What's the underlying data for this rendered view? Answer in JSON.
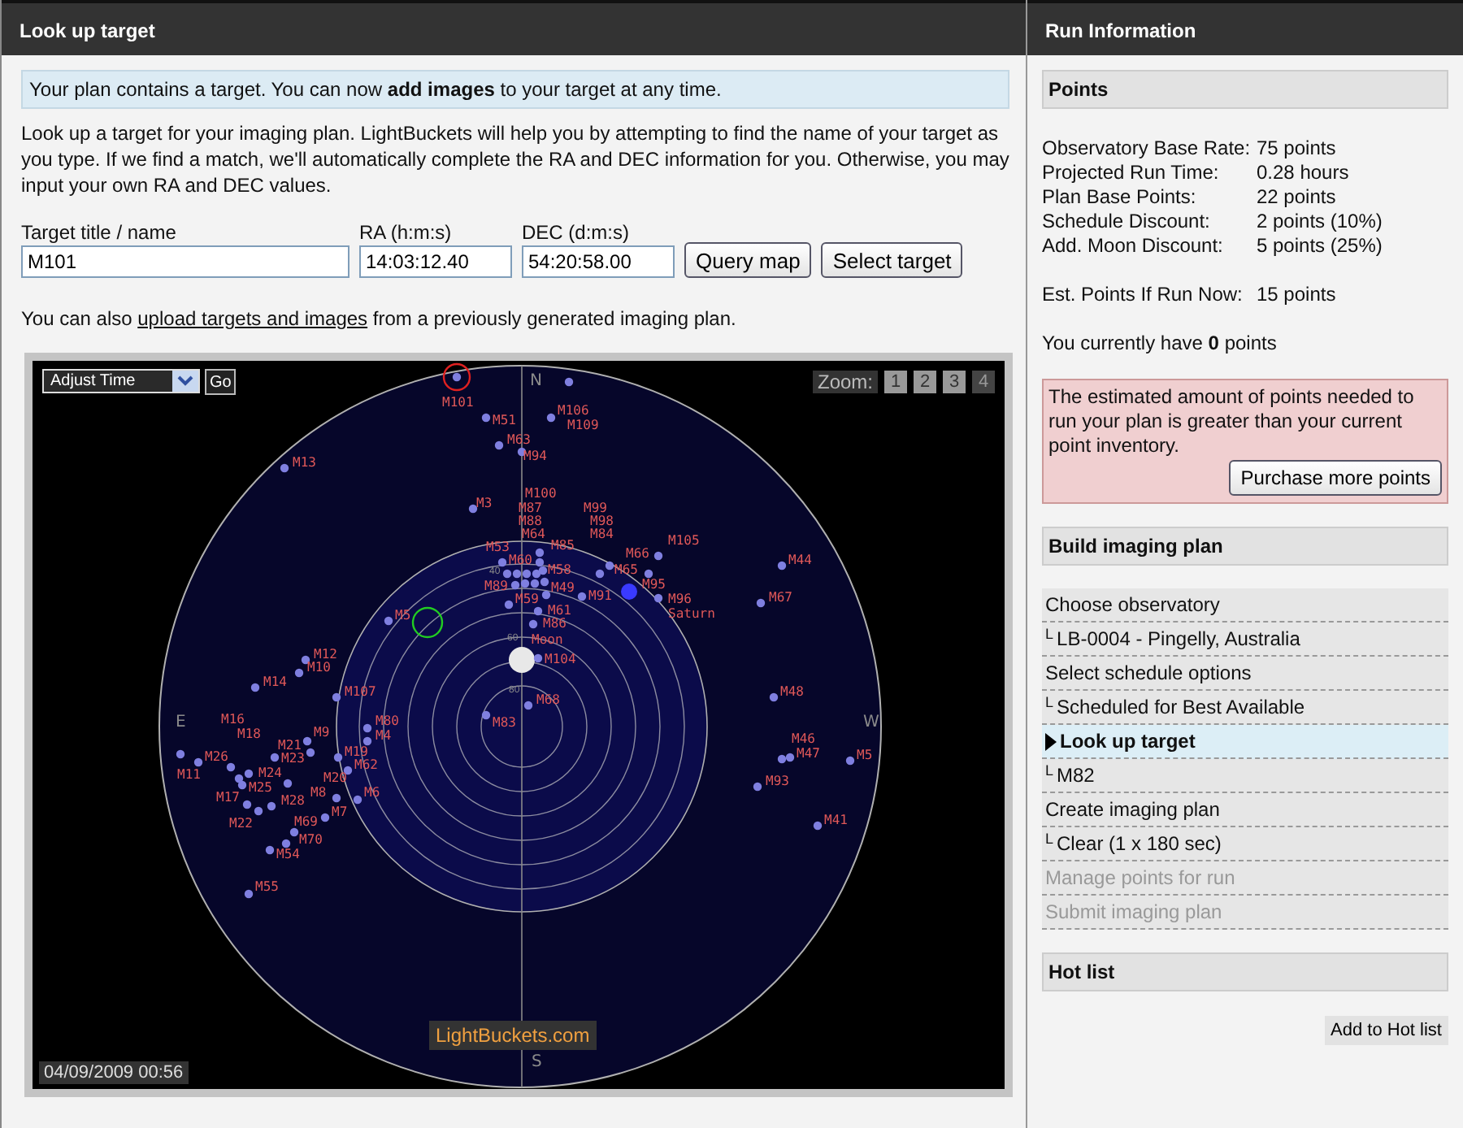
{
  "left_panel": {
    "title": "Look up target",
    "notice": "Your plan contains a target. You can now **add images** to your target at any time.",
    "intro": "Look up a target for your imaging plan. LightBuckets will help you by attempting to find the name of your target as you type. If we find a match, we'll automatically complete the RA and DEC information for you. Otherwise, you may input your own RA and DEC values.",
    "fields": [
      {
        "label": "Target title / name",
        "value": "M101"
      },
      {
        "label": "RA (h:m:s)",
        "value": "14:03:12.40"
      },
      {
        "label": "DEC (d:m:s)",
        "value": "54:20:58.00"
      }
    ],
    "buttons": [
      "Query map",
      "Select target"
    ],
    "upload_note": {
      "before": "You can also ",
      "link": "upload targets and images",
      "after": " from a previously generated imaging plan."
    },
    "sky_map": {
      "time_select": "Adjust Time",
      "go_button": "Go",
      "zoom_label": "Zoom:",
      "zoom_levels": [
        {
          "label": "1",
          "selected": false
        },
        {
          "label": "2",
          "selected": false
        },
        {
          "label": "3",
          "selected": false
        },
        {
          "label": "4",
          "selected": true
        }
      ],
      "compass": [
        "N",
        "E",
        "W",
        "S"
      ],
      "altitude_marks": [
        "40",
        "60",
        "80"
      ],
      "objects": [
        {
          "label": "M101",
          "kind": "messier",
          "selected": true
        },
        {
          "label": "M51",
          "kind": "messier",
          "selected": false
        },
        {
          "label": "M106",
          "kind": "messier",
          "selected": false
        },
        {
          "label": "M109",
          "kind": "messier",
          "selected": false
        },
        {
          "label": "M63",
          "kind": "messier",
          "selected": false
        },
        {
          "label": "M94",
          "kind": "messier",
          "selected": false
        },
        {
          "label": "M13",
          "kind": "messier",
          "selected": false
        },
        {
          "label": "M3",
          "kind": "messier",
          "selected": false
        },
        {
          "label": "M100",
          "kind": "messier",
          "selected": false
        },
        {
          "label": "M87",
          "kind": "messier",
          "selected": false
        },
        {
          "label": "M88",
          "kind": "messier",
          "selected": false
        },
        {
          "label": "M64",
          "kind": "messier",
          "selected": false
        },
        {
          "label": "M85",
          "kind": "messier",
          "selected": false
        },
        {
          "label": "M99",
          "kind": "messier",
          "selected": false
        },
        {
          "label": "M98",
          "kind": "messier",
          "selected": false
        },
        {
          "label": "M84",
          "kind": "messier",
          "selected": false
        },
        {
          "label": "M53",
          "kind": "messier",
          "selected": false
        },
        {
          "label": "M60",
          "kind": "messier",
          "selected": false
        },
        {
          "label": "M58",
          "kind": "messier",
          "selected": false
        },
        {
          "label": "M89",
          "kind": "messier",
          "selected": false
        },
        {
          "label": "M49",
          "kind": "messier",
          "selected": false
        },
        {
          "label": "M59",
          "kind": "messier",
          "selected": false
        },
        {
          "label": "M61",
          "kind": "messier",
          "selected": false
        },
        {
          "label": "M86",
          "kind": "messier",
          "selected": false
        },
        {
          "label": "Moon",
          "kind": "moon",
          "selected": false
        },
        {
          "label": "M104",
          "kind": "messier",
          "selected": false
        },
        {
          "label": "M68",
          "kind": "messier",
          "selected": false
        },
        {
          "label": "M83",
          "kind": "messier",
          "selected": false
        },
        {
          "label": "M66",
          "kind": "messier",
          "selected": false
        },
        {
          "label": "M65",
          "kind": "messier",
          "selected": false
        },
        {
          "label": "M105",
          "kind": "messier",
          "selected": false
        },
        {
          "label": "M95",
          "kind": "messier",
          "selected": false
        },
        {
          "label": "M91",
          "kind": "messier",
          "selected": false
        },
        {
          "label": "M96",
          "kind": "messier",
          "selected": false
        },
        {
          "label": "Saturn",
          "kind": "planet",
          "selected": false
        },
        {
          "label": "M44",
          "kind": "messier",
          "selected": false
        },
        {
          "label": "M67",
          "kind": "messier",
          "selected": false
        },
        {
          "label": "M48",
          "kind": "messier",
          "selected": false
        },
        {
          "label": "M5",
          "kind": "messier",
          "selected": false
        },
        {
          "label": "M12",
          "kind": "messier",
          "selected": false
        },
        {
          "label": "M10",
          "kind": "messier",
          "selected": false
        },
        {
          "label": "M14",
          "kind": "messier",
          "selected": false
        },
        {
          "label": "M107",
          "kind": "messier",
          "selected": false
        },
        {
          "label": "M80",
          "kind": "messier",
          "selected": false
        },
        {
          "label": "M9",
          "kind": "messier",
          "selected": false
        },
        {
          "label": "M4",
          "kind": "messier",
          "selected": false
        },
        {
          "label": "M16",
          "kind": "messier",
          "selected": false
        },
        {
          "label": "M18",
          "kind": "messier",
          "selected": false
        },
        {
          "label": "M21",
          "kind": "messier",
          "selected": false
        },
        {
          "label": "M26",
          "kind": "messier",
          "selected": false
        },
        {
          "label": "M23",
          "kind": "messier",
          "selected": false
        },
        {
          "label": "M11",
          "kind": "messier",
          "selected": false
        },
        {
          "label": "M19",
          "kind": "messier",
          "selected": false
        },
        {
          "label": "M62",
          "kind": "messier",
          "selected": false
        },
        {
          "label": "M24",
          "kind": "messier",
          "selected": false
        },
        {
          "label": "M20",
          "kind": "messier",
          "selected": false
        },
        {
          "label": "M25",
          "kind": "messier",
          "selected": false
        },
        {
          "label": "M17",
          "kind": "messier",
          "selected": false
        },
        {
          "label": "M28",
          "kind": "messier",
          "selected": false
        },
        {
          "label": "M8",
          "kind": "messier",
          "selected": false
        },
        {
          "label": "M6",
          "kind": "messier",
          "selected": false
        },
        {
          "label": "M7",
          "kind": "messier",
          "selected": false
        },
        {
          "label": "M22",
          "kind": "messier",
          "selected": false
        },
        {
          "label": "M69",
          "kind": "messier",
          "selected": false
        },
        {
          "label": "M70",
          "kind": "messier",
          "selected": false
        },
        {
          "label": "M54",
          "kind": "messier",
          "selected": false
        },
        {
          "label": "M55",
          "kind": "messier",
          "selected": false
        },
        {
          "label": "M46",
          "kind": "messier",
          "selected": false
        },
        {
          "label": "M47",
          "kind": "messier",
          "selected": false
        },
        {
          "label": "M5",
          "kind": "messier",
          "selected": false
        },
        {
          "label": "M93",
          "kind": "messier",
          "selected": false
        },
        {
          "label": "M41",
          "kind": "messier",
          "selected": false
        }
      ],
      "timestamp": "04/09/2009 00:56",
      "logo": "LightBuckets.com"
    }
  },
  "right_panel": {
    "title": "Run Information",
    "points": {
      "heading": "Points",
      "rows": [
        {
          "label": "Observatory Base Rate:",
          "value": "75 points"
        },
        {
          "label": "Projected Run Time:",
          "value": "0.28 hours"
        },
        {
          "label": "Plan Base Points:",
          "value": "22 points"
        },
        {
          "label": "Schedule Discount:",
          "value": "2 points (10%)"
        },
        {
          "label": "Add. Moon Discount:",
          "value": "5 points (25%)"
        }
      ],
      "estimate": {
        "label": "Est. Points If Run Now:",
        "value": "15 points"
      },
      "balance": "You currently have **0** points",
      "alert": "The estimated amount of points needed to run your plan is greater than your current point inventory.",
      "purchase_button": "Purchase more points"
    },
    "build": {
      "heading": "Build imaging plan",
      "steps": [
        {
          "label": "Choose observatory",
          "kind": "step",
          "active": false,
          "disabled": false
        },
        {
          "label": "LB-0004 - Pingelly, Australia",
          "kind": "detail",
          "prefix": "L",
          "active": false,
          "disabled": false
        },
        {
          "label": "Select schedule options",
          "kind": "step",
          "active": false,
          "disabled": false
        },
        {
          "label": "Scheduled for Best Available",
          "kind": "detail",
          "prefix": "L",
          "active": false,
          "disabled": false
        },
        {
          "label": "Look up target",
          "kind": "step",
          "active": true,
          "disabled": false
        },
        {
          "label": "M82",
          "kind": "detail",
          "prefix": "L",
          "active": false,
          "disabled": false
        },
        {
          "label": "Create imaging plan",
          "kind": "step",
          "active": false,
          "disabled": false
        },
        {
          "label": "Clear (1 x 180 sec)",
          "kind": "detail",
          "prefix": "L",
          "active": false,
          "disabled": false
        },
        {
          "label": "Manage points for run",
          "kind": "step",
          "active": false,
          "disabled": true
        },
        {
          "label": "Submit imaging plan",
          "kind": "step",
          "active": false,
          "disabled": true
        }
      ]
    },
    "hot_list": {
      "heading": "Hot list",
      "button": "Add to Hot list"
    }
  }
}
